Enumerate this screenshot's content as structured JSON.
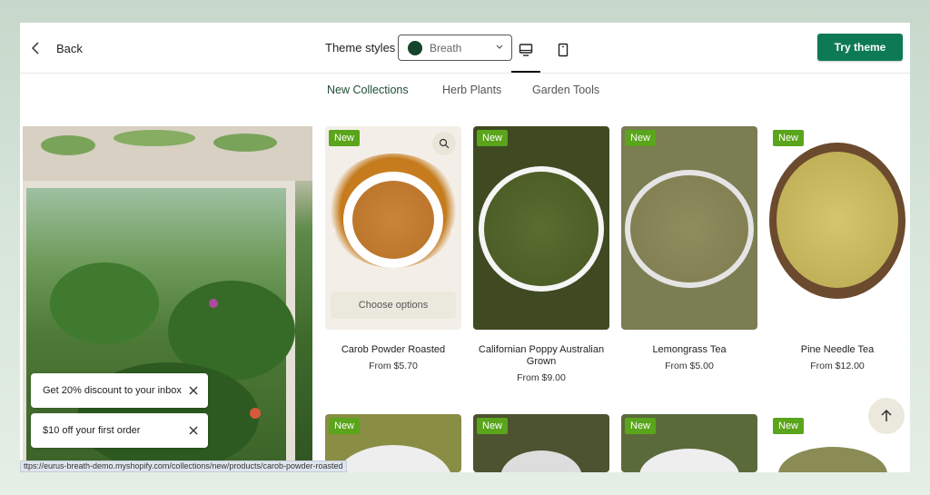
{
  "topbar": {
    "back_label": "Back",
    "theme_styles_label": "Theme styles",
    "theme_selected": "Breath",
    "theme_swatch_color": "#17452a",
    "try_button_label": "Try theme",
    "try_button_color": "#0e7a55"
  },
  "tabs": [
    {
      "label": "New Collections",
      "active": true
    },
    {
      "label": "Herb Plants",
      "active": false
    },
    {
      "label": "Garden Tools",
      "active": false
    }
  ],
  "products": [
    {
      "title": "Carob Powder Roasted",
      "price": "From $5.70",
      "badge": "New",
      "cta": "Choose options"
    },
    {
      "title": "Californian Poppy Australian Grown",
      "price": "From $9.00",
      "badge": "New"
    },
    {
      "title": "Lemongrass Tea",
      "price": "From $5.00",
      "badge": "New"
    },
    {
      "title": "Pine Needle Tea",
      "price": "From $12.00",
      "badge": "New"
    }
  ],
  "second_row_badges": [
    "New",
    "New",
    "New",
    "New"
  ],
  "popups": [
    {
      "text": "Get 20% discount to your inbox"
    },
    {
      "text": "$10 off your first order"
    }
  ],
  "status_url": "ttps://eurus-breath-demo.myshopify.com/collections/new/products/carob-powder-roasted",
  "colors": {
    "badge": "#5aa51b",
    "active_tab": "#1f4d35"
  }
}
